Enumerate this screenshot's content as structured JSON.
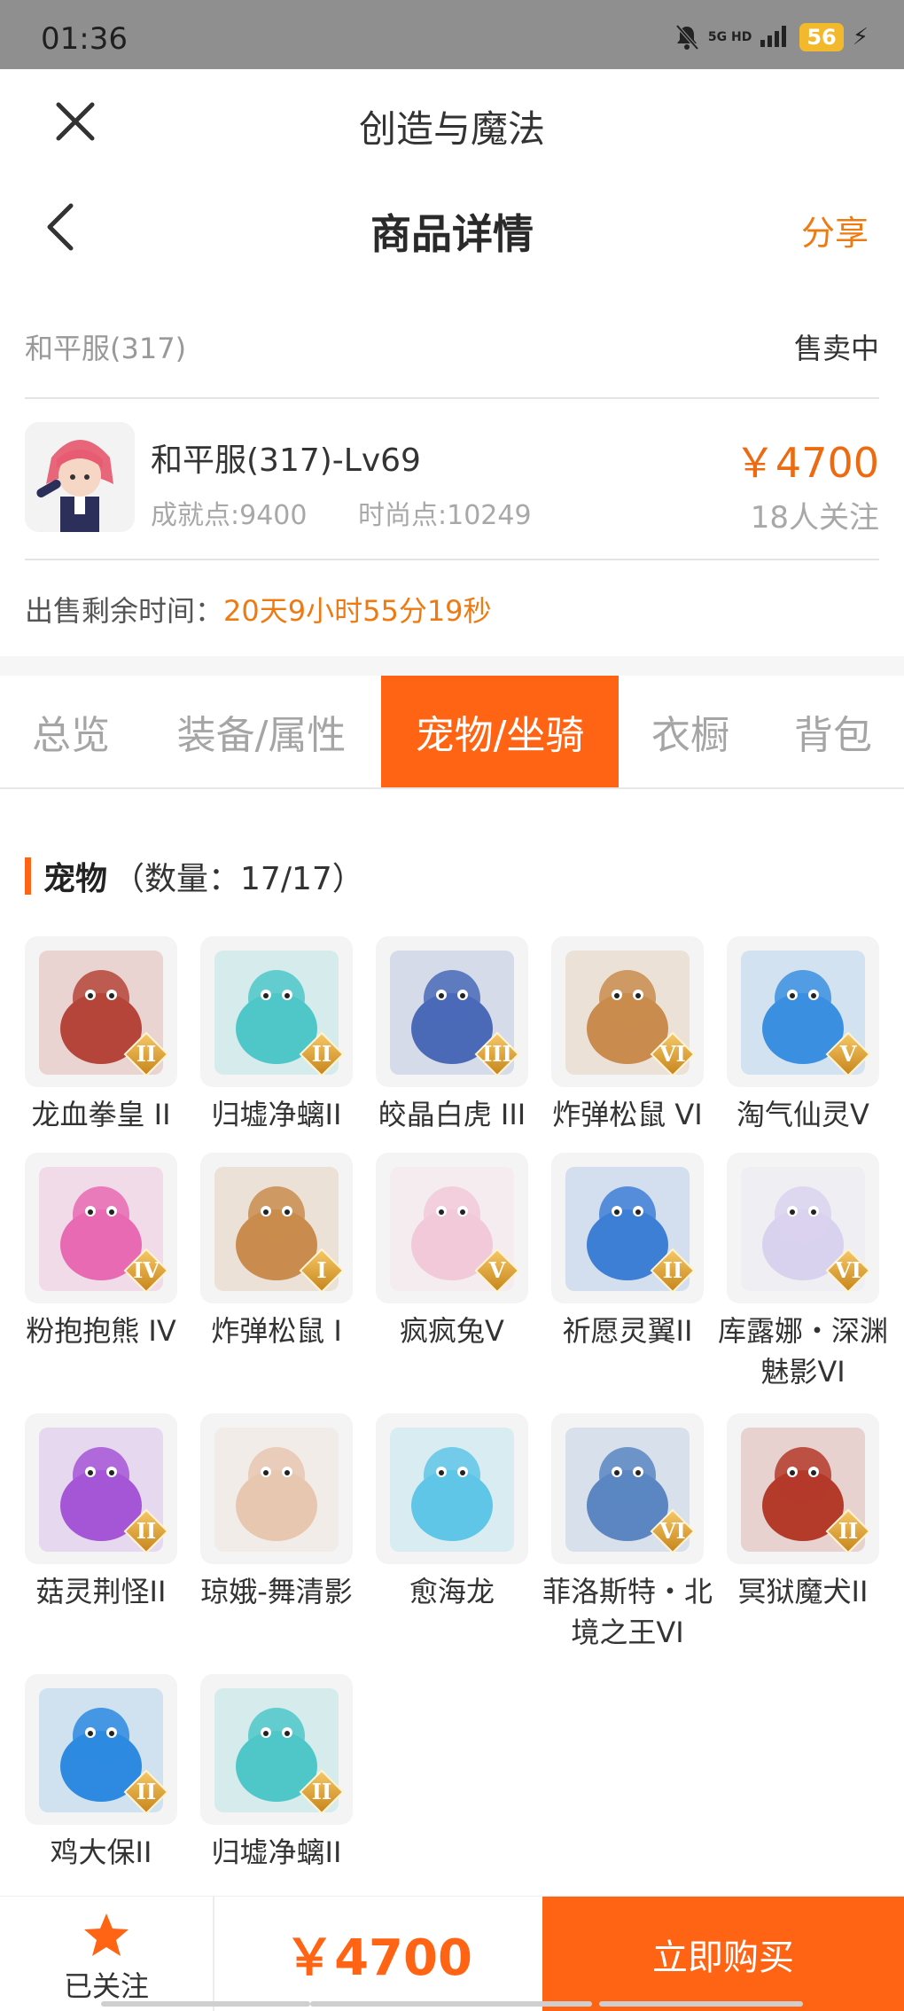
{
  "status_bar": {
    "time": "01:36",
    "network": "5G HD",
    "battery": "56"
  },
  "title_bar": {
    "title": "创造与魔法"
  },
  "nav": {
    "title": "商品详情",
    "share": "分享"
  },
  "listing": {
    "server": "和平服(317)",
    "status": "售卖中",
    "name": "和平服(317)-Lv69",
    "achievement": "成就点:9400",
    "fashion": "时尚点:10249",
    "price": "￥4700",
    "followers": "18人关注",
    "time_label": "出售剩余时间：",
    "time_remaining": "20天9小时55分19秒"
  },
  "tabs": [
    {
      "label": "总览"
    },
    {
      "label": "装备/属性"
    },
    {
      "label": "宠物/坐骑"
    },
    {
      "label": "衣橱"
    },
    {
      "label": "背包"
    }
  ],
  "active_tab": "宠物/坐骑",
  "pets_section": {
    "title": "宠物",
    "count": "（数量：17/17）"
  },
  "pets": [
    {
      "name": "龙血拳皇 II",
      "rank": "II",
      "color": "#b5453a"
    },
    {
      "name": "归墟净螭II",
      "rank": "II",
      "color": "#4fc7c9"
    },
    {
      "name": "皎晶白虎 III",
      "rank": "III",
      "color": "#4a6ab8"
    },
    {
      "name": "炸弹松鼠 VI",
      "rank": "VI",
      "color": "#c98c4e"
    },
    {
      "name": "淘气仙灵V",
      "rank": "V",
      "color": "#3b8fe0"
    },
    {
      "name": "粉抱抱熊 IV",
      "rank": "IV",
      "color": "#e86ab3"
    },
    {
      "name": "炸弹松鼠 I",
      "rank": "I",
      "color": "#c98c4e"
    },
    {
      "name": "疯疯兔V",
      "rank": "V",
      "color": "#f2c9d8"
    },
    {
      "name": "祈愿灵翼II",
      "rank": "II",
      "color": "#3e7fd6"
    },
    {
      "name": "库露娜・深渊魅影VI",
      "rank": "VI",
      "color": "#d9d2ef"
    },
    {
      "name": "菇灵荆怪II",
      "rank": "II",
      "color": "#a456d6"
    },
    {
      "name": "琼娥-舞清影",
      "rank": "",
      "color": "#e8c7b0"
    },
    {
      "name": "愈海龙",
      "rank": "",
      "color": "#5fc6e8"
    },
    {
      "name": "菲洛斯特・北境之王VI",
      "rank": "VI",
      "color": "#5b86c2"
    },
    {
      "name": "冥狱魔犬II",
      "rank": "II",
      "color": "#b43a2a"
    },
    {
      "name": "鸡大保II",
      "rank": "II",
      "color": "#2d8ae0"
    },
    {
      "name": "归墟净螭II",
      "rank": "II",
      "color": "#4fc7c9"
    }
  ],
  "bottom_bar": {
    "follow_label": "已关注",
    "price": "￥4700",
    "buy_label": "立即购买"
  },
  "colors": {
    "accent": "#ff6414",
    "price": "#ee6a10",
    "muted": "#a8a8a8"
  }
}
